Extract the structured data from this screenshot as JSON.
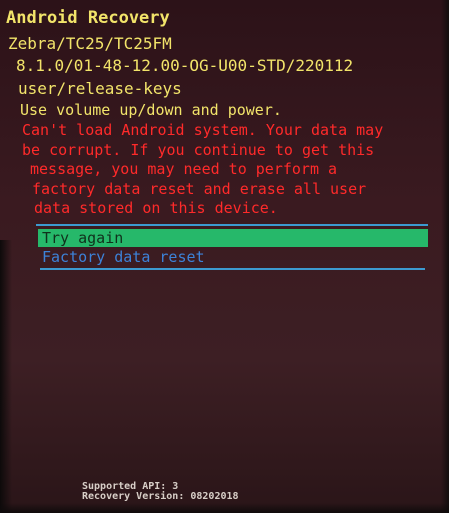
{
  "header": {
    "title": "Android Recovery",
    "device": "Zebra/TC25/TC25FM",
    "build": "8.1.0/01-48-12.00-OG-U00-STD/220112",
    "keys": "user/release-keys",
    "instructions": "Use volume up/down and power."
  },
  "error": {
    "lines": [
      "Can't load Android system. Your data may",
      "be corrupt. If you continue to get this",
      "message, you may need to perform a",
      "factory data reset and erase all user",
      "data stored on this device."
    ]
  },
  "menu": {
    "items": [
      {
        "label": "Try again",
        "selected": true
      },
      {
        "label": "Factory data reset",
        "selected": false
      }
    ]
  },
  "footer": {
    "api": "Supported API: 3",
    "version": "Recovery Version: 08202018"
  },
  "colors": {
    "title": "#f2e46a",
    "error": "#ff2a2a",
    "selected_bg": "#26b86a",
    "menu_text": "#3c82d8",
    "divider": "#3c9ad0",
    "background": "#3a1a20"
  }
}
